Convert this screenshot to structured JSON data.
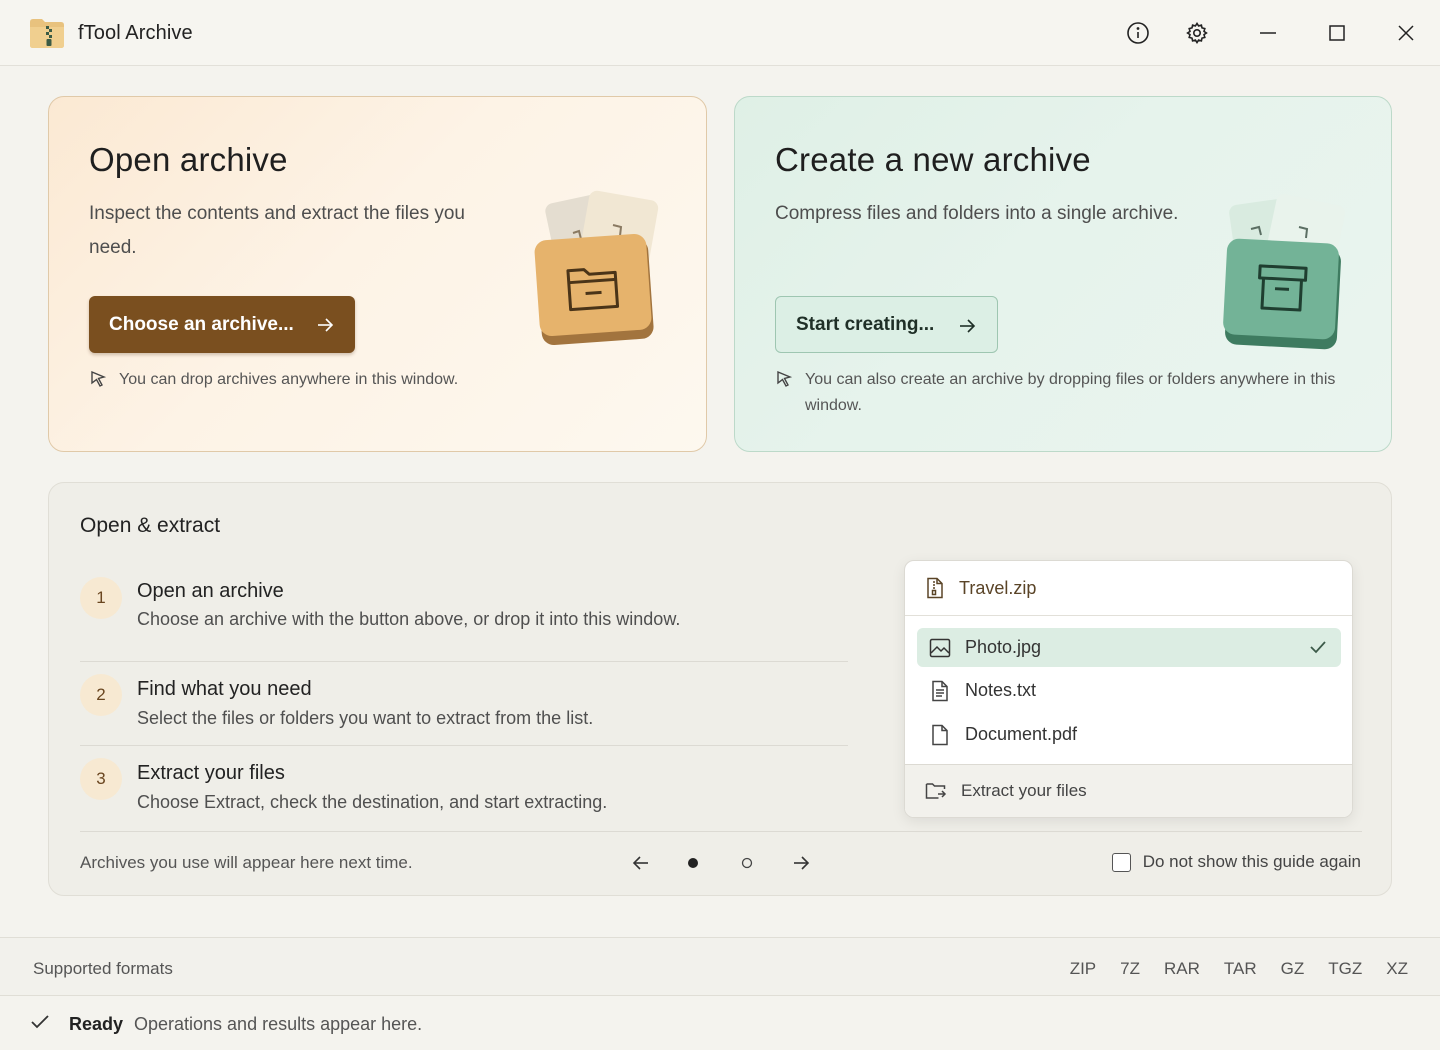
{
  "app": {
    "title": "fTool Archive"
  },
  "titlebar": {
    "icons": [
      "info-icon",
      "gear-icon",
      "minimize-icon",
      "maximize-icon",
      "close-icon"
    ]
  },
  "open_card": {
    "title": "Open archive",
    "description": "Inspect the contents and extract the files you need.",
    "button_label": "Choose an archive...",
    "hint": "You can drop archives anywhere in this window."
  },
  "create_card": {
    "title": "Create a new archive",
    "description": "Compress files and folders into a single archive.",
    "button_label": "Start creating...",
    "hint": "You can also create an archive by dropping files or folders anywhere in this window."
  },
  "guide": {
    "title": "Open & extract",
    "steps": [
      {
        "number": "1",
        "title": "Open an archive",
        "description": "Choose an archive with the button above, or drop it into this window."
      },
      {
        "number": "2",
        "title": "Find what you need",
        "description": "Select the files or folders you want to extract from the list."
      },
      {
        "number": "3",
        "title": "Extract your files",
        "description": "Choose Extract, check the destination, and start extracting."
      }
    ],
    "preview": {
      "archive_name": "Travel.zip",
      "files": [
        {
          "name": "Photo.jpg",
          "icon": "image-icon",
          "selected": true
        },
        {
          "name": "Notes.txt",
          "icon": "text-file-icon",
          "selected": false
        },
        {
          "name": "Document.pdf",
          "icon": "document-icon",
          "selected": false
        }
      ],
      "action_label": "Extract your files"
    },
    "recent_note": "Archives you use will appear here next time.",
    "pager": {
      "current_page": 1,
      "total_pages": 2
    },
    "dont_show_label": "Do not show this guide again",
    "dont_show_checked": false
  },
  "formats": {
    "label": "Supported formats",
    "items": [
      "ZIP",
      "7Z",
      "RAR",
      "TAR",
      "GZ",
      "TGZ",
      "XZ"
    ]
  },
  "status": {
    "label": "Ready",
    "message": "Operations and results appear here."
  },
  "colors": {
    "primary_brown": "#7a4f1f",
    "accent_green": "#dcede3",
    "background": "#f4f3ee"
  }
}
